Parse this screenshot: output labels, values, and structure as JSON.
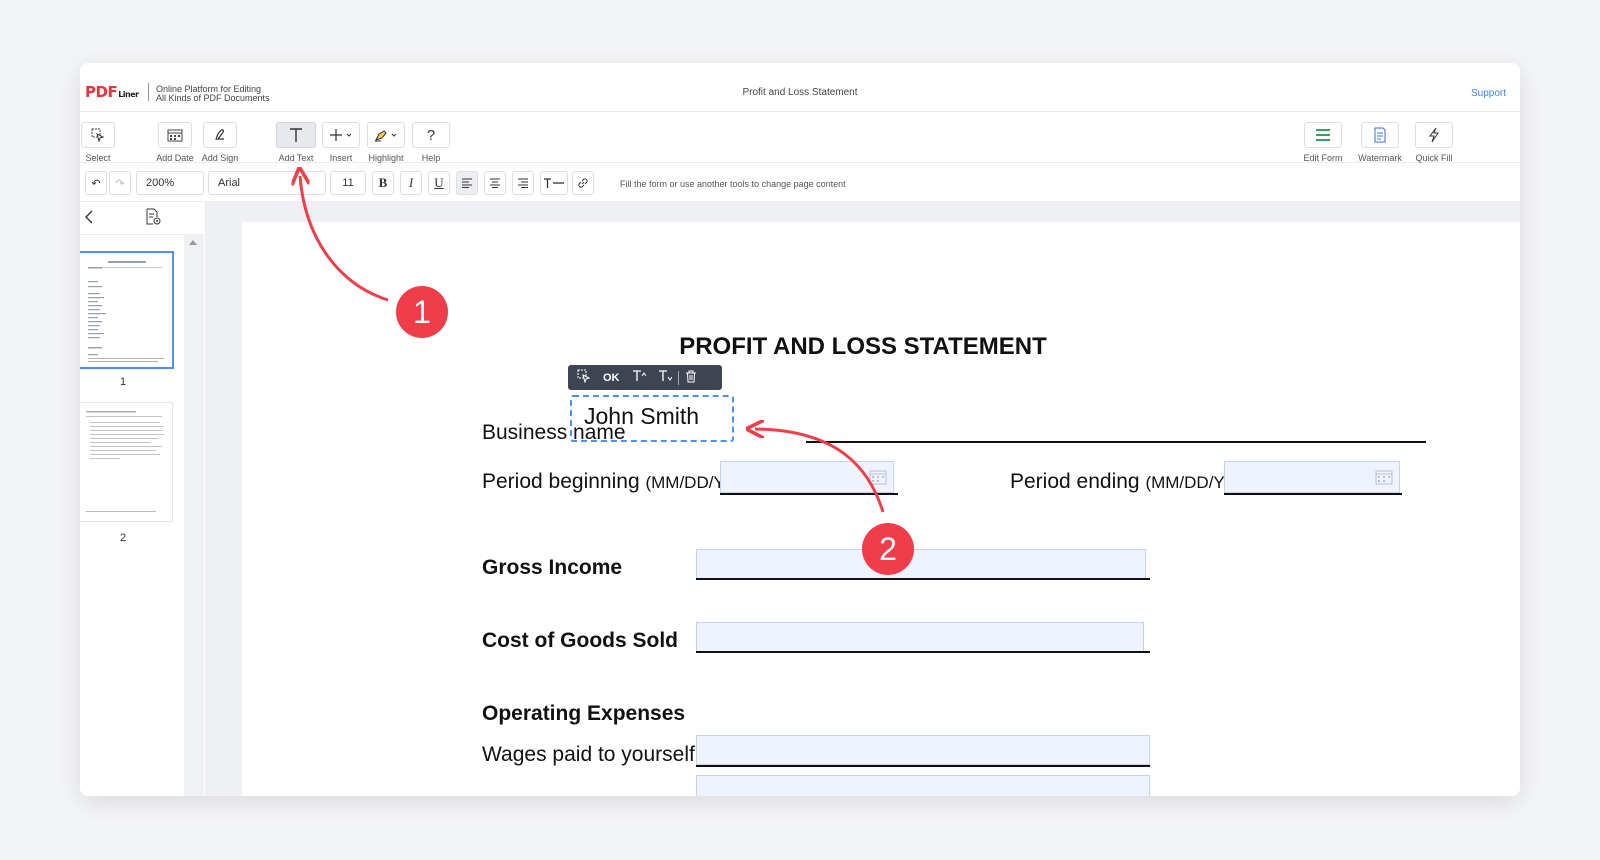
{
  "app": {
    "logo_main": "PDF",
    "logo_sub": "Liner",
    "tagline_line1": "Online Platform for Editing",
    "tagline_line2": "All Kinds of PDF Documents",
    "document_title": "Profit and Loss Statement",
    "support_label": "Support"
  },
  "toolbar": {
    "left_tools": [
      {
        "label": "Select",
        "icon": "select-cursor-icon"
      },
      {
        "label": "Add Date",
        "icon": "calendar-icon"
      },
      {
        "label": "Add Sign",
        "icon": "signature-icon"
      },
      {
        "label": "Add Text",
        "icon": "text-icon"
      },
      {
        "label": "Insert",
        "icon": "plus-icon"
      },
      {
        "label": "Highlight",
        "icon": "highlighter-icon"
      },
      {
        "label": "Help",
        "icon": "question-icon"
      }
    ],
    "right_tools": [
      {
        "label": "Edit Form",
        "icon": "form-icon"
      },
      {
        "label": "Watermark",
        "icon": "watermark-icon"
      },
      {
        "label": "Quick Fill",
        "icon": "lightning-icon"
      }
    ]
  },
  "format": {
    "zoom": "200%",
    "font": "Arial",
    "size": "11",
    "hint": "Fill the form or use another tools to change page content"
  },
  "sidebar": {
    "pages": [
      {
        "number": "1"
      },
      {
        "number": "2"
      }
    ]
  },
  "document": {
    "heading": "PROFIT AND LOSS STATEMENT",
    "business_name_label": "Business name",
    "business_name_value": "John Smith",
    "period_beginning_label": "Period beginning",
    "period_beginning_hint": "(MM/DD/YYYY)",
    "period_ending_label": "Period ending",
    "period_ending_hint": "(MM/DD/YYYY)",
    "gross_income_label": "Gross Income",
    "cogs_label": "Cost of Goods Sold",
    "operating_expenses_label": "Operating Expenses",
    "wages_label": "Wages paid to yourself"
  },
  "context_toolbar": {
    "ok_label": "OK"
  },
  "annotations": {
    "badge1": "1",
    "badge2": "2",
    "color": "#ef3e4a"
  }
}
